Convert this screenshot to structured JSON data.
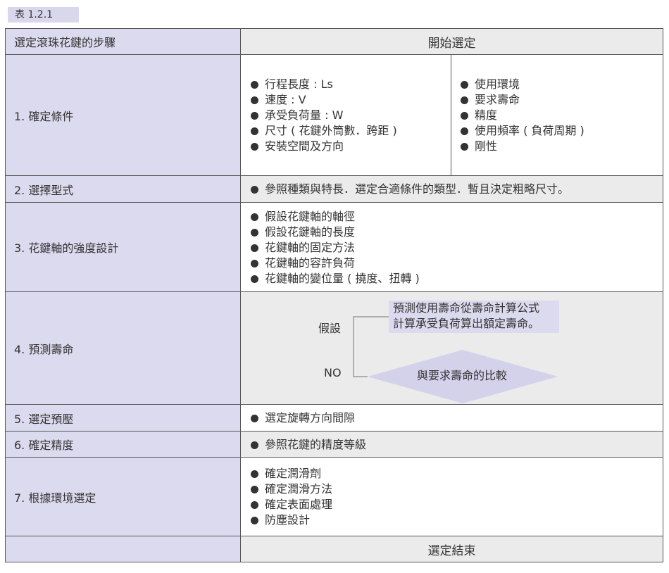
{
  "caption": "表 1.2.1",
  "header": {
    "left": "選定滾珠花鍵的步驟",
    "right": "開始選定"
  },
  "row1": {
    "label": "1. 確定條件",
    "col_a": [
      "行程長度 : Ls",
      "速度 : V",
      "承受負荷量 : W",
      "尺寸 ( 花鍵外筒數．跨距 )",
      "安裝空間及方向"
    ],
    "col_b": [
      "使用環境",
      "要求壽命",
      "精度",
      "使用頻率 ( 負荷周期 )",
      "剛性"
    ]
  },
  "row2": {
    "label": "2. 選擇型式",
    "items": [
      "參照種類與特長．選定合適條件的類型．暫且決定粗略尺寸。"
    ]
  },
  "row3": {
    "label": "3. 花鍵軸的強度設計",
    "items": [
      "假設花鍵軸的軸徑",
      "假設花鍵軸的長度",
      "花鍵軸的固定方法",
      "花鍵軸的容許負荷",
      "花鍵軸的變位量 ( 撓度、扭轉 )"
    ]
  },
  "row4": {
    "label": "4. 預測壽命",
    "assume": "假設",
    "note_line1": "預測使用壽命從壽命計算公式",
    "note_line2": "計算承受負荷算出額定壽命。",
    "no": "NO",
    "compare": "與要求壽命的比較"
  },
  "row5": {
    "label": "5. 選定預壓",
    "items": [
      "選定旋轉方向間隙"
    ]
  },
  "row6": {
    "label": "6. 確定精度",
    "items": [
      "參照花鍵的精度等級"
    ]
  },
  "row7": {
    "label": "7. 根據環境選定",
    "items": [
      "確定潤滑劑",
      "確定潤滑方法",
      "確定表面處理",
      "防塵設計"
    ]
  },
  "footer": {
    "left": "",
    "right": "選定結束"
  },
  "colors": {
    "label_bg": "#dcdaee",
    "gray_bg": "#ebebeb",
    "border": "#555555"
  }
}
